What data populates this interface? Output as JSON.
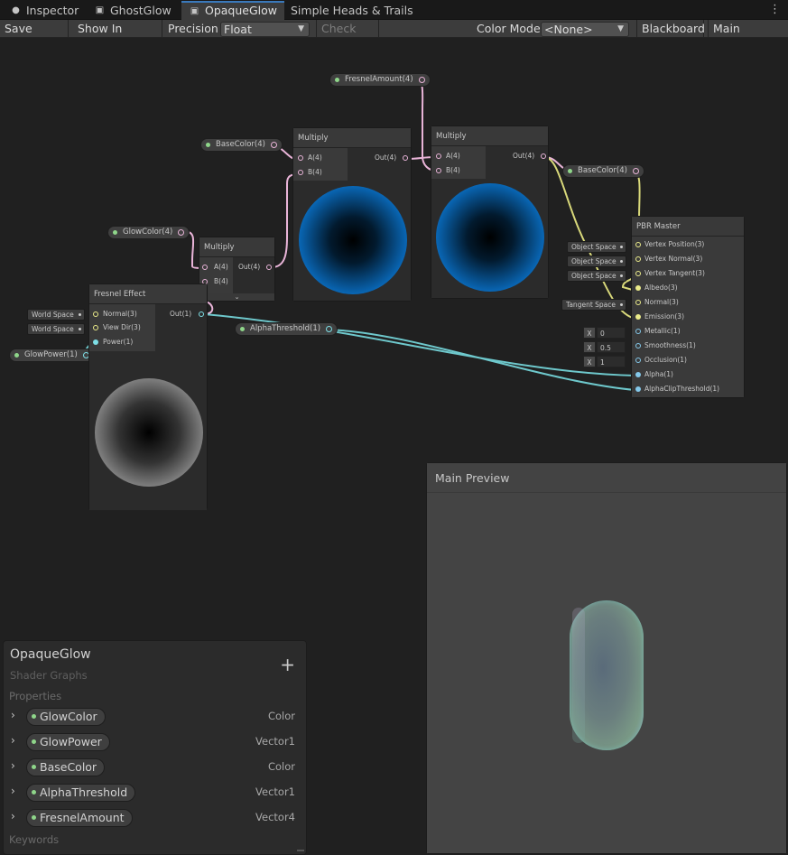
{
  "tabs": [
    {
      "label": "Inspector",
      "icon": "info-icon"
    },
    {
      "label": "GhostGlow",
      "icon": "shader-graph-icon"
    },
    {
      "label": "OpaqueGlow",
      "icon": "shader-graph-icon",
      "active": true
    },
    {
      "label": "Simple Heads & Trails",
      "icon": ""
    }
  ],
  "toolbar": {
    "save_asset": "Save Asset",
    "show_in_project": "Show In Project",
    "precision_label": "Precision",
    "precision_value": "Float",
    "check_out": "Check Out",
    "color_mode_label": "Color Mode",
    "color_mode_value": "<None>",
    "blackboard": "Blackboard",
    "main_preview": "Main Preview"
  },
  "graph": {
    "props": {
      "fresnel_amount": "FresnelAmount(4)",
      "base_color_a": "BaseColor(4)",
      "glow_color": "GlowColor(4)",
      "glow_power": "GlowPower(1)",
      "alpha_threshold": "AlphaThreshold(1)",
      "base_color_b": "BaseColor(4)"
    },
    "multiply_small": {
      "title": "Multiply",
      "in_a": "A(4)",
      "in_b": "B(4)",
      "out": "Out(4)"
    },
    "multiply_mid": {
      "title": "Multiply",
      "in_a": "A(4)",
      "in_b": "B(4)",
      "out": "Out(4)"
    },
    "multiply_right": {
      "title": "Multiply",
      "in_a": "A(4)",
      "in_b": "B(4)",
      "out": "Out(4)"
    },
    "fresnel": {
      "title": "Fresnel Effect",
      "normal": "Normal(3)",
      "view_dir": "View Dir(3)",
      "power": "Power(1)",
      "out": "Out(1)",
      "normal_space": "World Space",
      "view_space": "World Space"
    },
    "pbr": {
      "title": "PBR Master",
      "ports": [
        "Vertex Position(3)",
        "Vertex Normal(3)",
        "Vertex Tangent(3)",
        "Albedo(3)",
        "Normal(3)",
        "Emission(3)",
        "Metallic(1)",
        "Smoothness(1)",
        "Occlusion(1)",
        "Alpha(1)",
        "AlphaClipThreshold(1)"
      ],
      "space_tags": [
        "Object Space",
        "Object Space",
        "Object Space",
        "Tangent Space"
      ],
      "x_label": "X",
      "metallic": "0",
      "smoothness": "0.5",
      "occlusion": "1"
    }
  },
  "main_preview": {
    "title": "Main Preview"
  },
  "blackboard": {
    "title": "OpaqueGlow",
    "subtitle": "Shader Graphs",
    "add": "+",
    "properties_label": "Properties",
    "keywords_label": "Keywords",
    "properties": [
      {
        "name": "GlowColor",
        "type": "Color"
      },
      {
        "name": "GlowPower",
        "type": "Vector1"
      },
      {
        "name": "BaseColor",
        "type": "Color"
      },
      {
        "name": "AlphaThreshold",
        "type": "Vector1"
      },
      {
        "name": "FresnelAmount",
        "type": "Vector4"
      }
    ]
  },
  "colors": {
    "accent": "#3a79bb",
    "wire_pink": "#e9b4d8",
    "wire_cyan": "#6ec8cc",
    "wire_yellow": "#d8d87a",
    "property_dot": "#8fd68a"
  }
}
